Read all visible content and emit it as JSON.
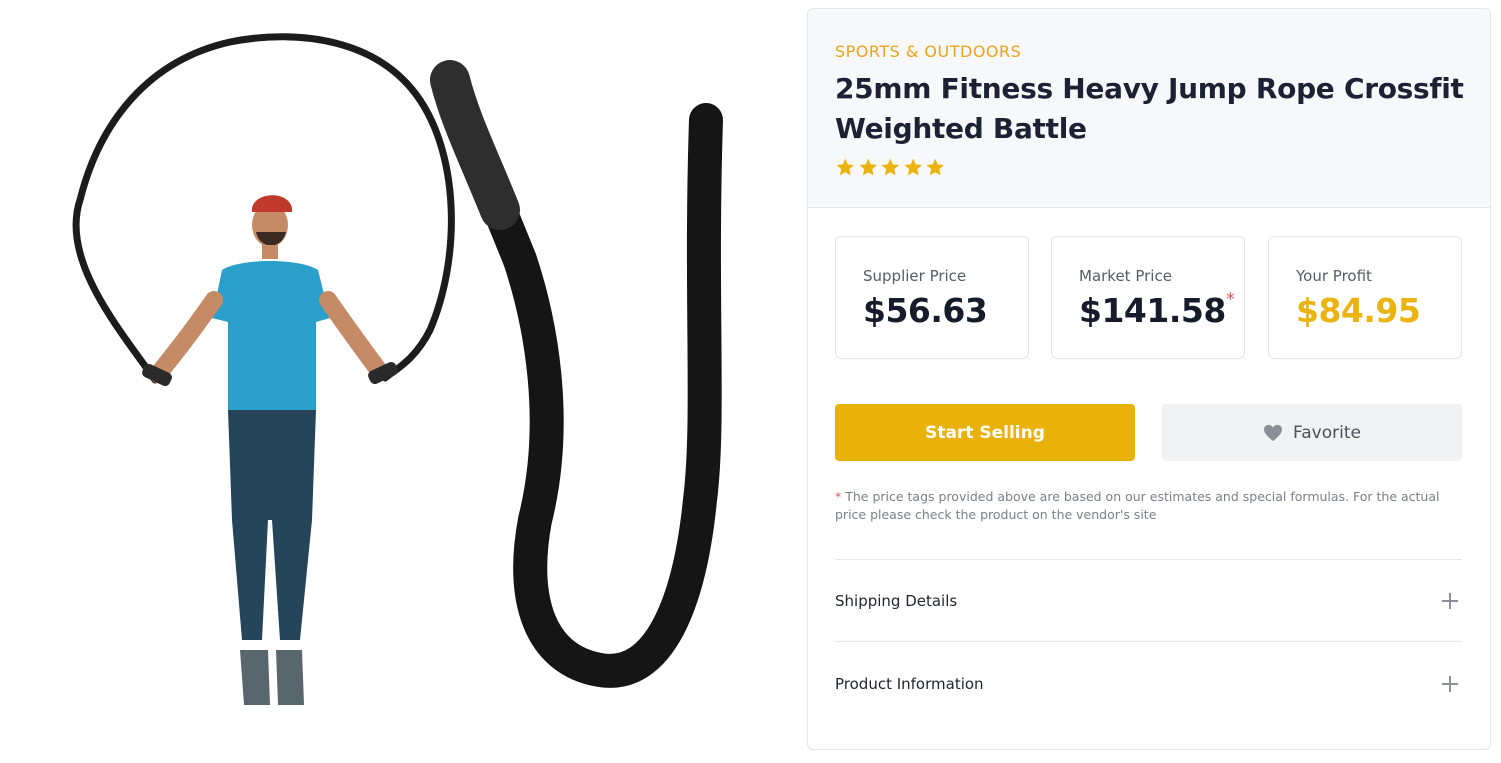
{
  "product": {
    "category": "SPORTS & OUTDOORS",
    "title": "25mm Fitness Heavy Jump Rope Crossfit Weighted Battle",
    "rating_stars": 5,
    "image_icon": "product-photo-jump-rope"
  },
  "prices": {
    "supplier": {
      "label": "Supplier Price",
      "value": "$56.63"
    },
    "market": {
      "label": "Market Price",
      "value": "$141.58",
      "asterisk": "*"
    },
    "profit": {
      "label": "Your Profit",
      "value": "$84.95"
    }
  },
  "actions": {
    "start_selling_label": "Start Selling",
    "favorite_label": "Favorite",
    "favorite_icon": "heart-icon"
  },
  "disclaimer": {
    "asterisk": "*",
    "text": " The price tags provided above are based on our estimates and special formulas. For the actual price please check the product on the vendor's site"
  },
  "accordions": [
    {
      "label": "Shipping Details",
      "icon": "plus-icon"
    },
    {
      "label": "Product Information",
      "icon": "plus-icon"
    }
  ],
  "colors": {
    "accent": "#e9b20a",
    "category": "#e9a31a",
    "profit": "#eab30d",
    "asterisk": "#e35b5b"
  }
}
